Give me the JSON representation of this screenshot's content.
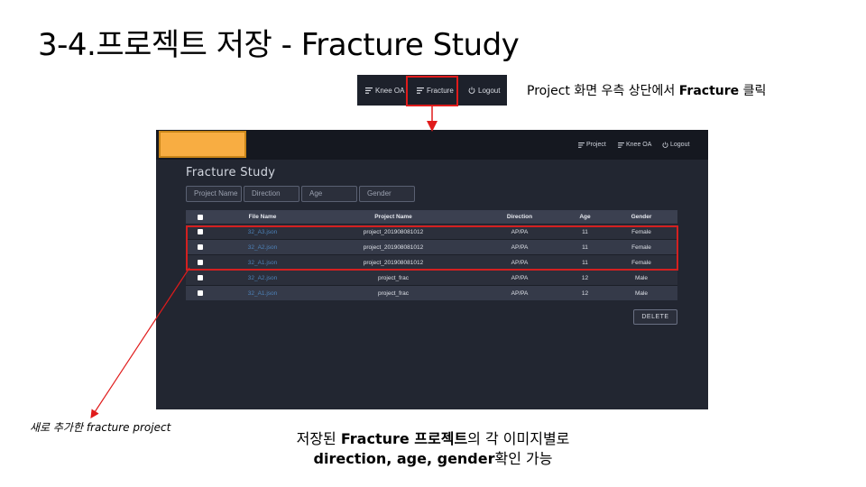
{
  "slide": {
    "title": "3-4.프로젝트 저장 - Fracture Study"
  },
  "nav_snippet": {
    "items": [
      {
        "label": "Knee OA",
        "icon": "list-icon"
      },
      {
        "label": "Fracture",
        "icon": "list-icon"
      },
      {
        "label": "Logout",
        "icon": "power-icon"
      }
    ]
  },
  "caption_right": {
    "prefix": "Project 화면 우측 상단에서 ",
    "bold": "Fracture",
    "suffix": " 클릭"
  },
  "app": {
    "nav": [
      {
        "label": "Project",
        "icon": "list-icon"
      },
      {
        "label": "Knee OA",
        "icon": "list-icon"
      },
      {
        "label": "Logout",
        "icon": "power-icon"
      }
    ],
    "heading": "Fracture Study",
    "filters": [
      {
        "placeholder": "Project Name"
      },
      {
        "placeholder": "Direction"
      },
      {
        "placeholder": "Age"
      },
      {
        "placeholder": "Gender"
      }
    ],
    "table": {
      "headers": [
        "",
        "File Name",
        "Project Name",
        "Direction",
        "Age",
        "Gender"
      ],
      "rows": [
        [
          "",
          "32_A3.json",
          "project_201908081012",
          "AP/PA",
          "11",
          "Female"
        ],
        [
          "",
          "32_A2.json",
          "project_201908081012",
          "AP/PA",
          "11",
          "Female"
        ],
        [
          "",
          "32_A1.json",
          "project_201908081012",
          "AP/PA",
          "11",
          "Female"
        ],
        [
          "",
          "32_A2.json",
          "project_frac",
          "AP/PA",
          "12",
          "Male"
        ],
        [
          "",
          "32_A1.json",
          "project_frac",
          "AP/PA",
          "12",
          "Male"
        ]
      ]
    },
    "delete_label": "DELETE"
  },
  "annotation_left": {
    "text": "새로 추가한 fracture project"
  },
  "caption_bottom": {
    "line1_prefix": "저장된 ",
    "line1_bold": "Fracture 프로젝트",
    "line1_suffix": "의 각 이미지별로",
    "line2_bold": "direction, age, gender",
    "line2_suffix": "확인 가능"
  },
  "colors": {
    "highlight": "#e01b1b",
    "logo": "#f8ad42",
    "app_bg": "#262a36",
    "link": "#4d82b8"
  }
}
